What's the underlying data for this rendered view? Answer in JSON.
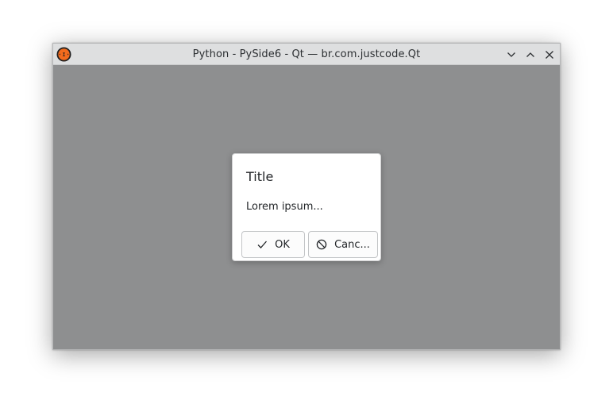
{
  "window": {
    "title": "Python - PySide6 - Qt — br.com.justcode.Qt",
    "controls": [
      "minimize",
      "maximize",
      "close"
    ],
    "app_icon": "python-app-icon",
    "accent": "#f26b1d"
  },
  "dialog": {
    "title": "Title",
    "message": "Lorem ipsum...",
    "ok_label": "OK",
    "ok_icon": "checkmark-icon",
    "cancel_label": "Canc...",
    "cancel_icon": "cancel-circle-icon"
  }
}
